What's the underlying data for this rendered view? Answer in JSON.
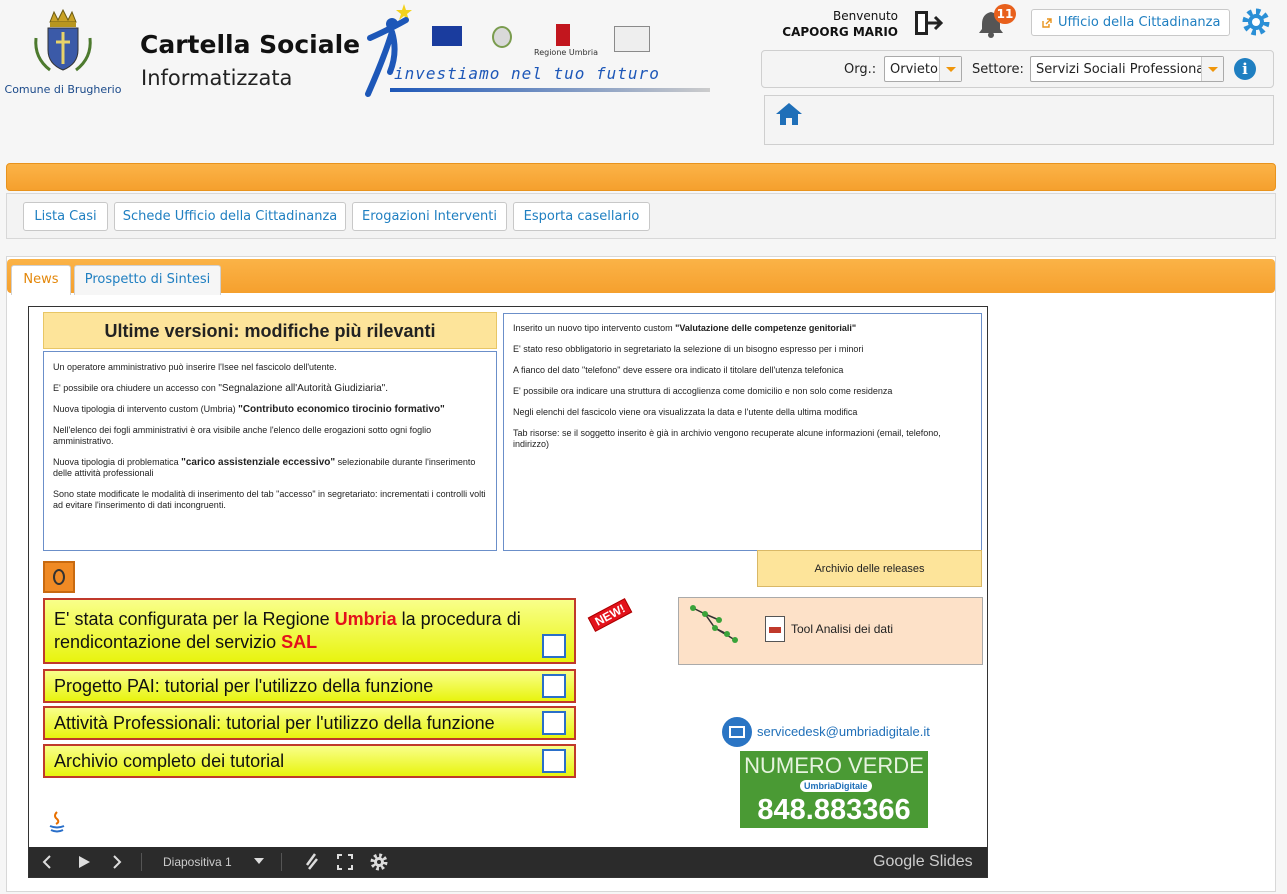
{
  "header": {
    "comune": "Comune di Brugherio",
    "app_title": "Cartella Sociale",
    "app_subtitle": "Informatizzata",
    "banner_text": "investiamo nel tuo futuro",
    "banner_region": "Regione Umbria",
    "welcome": "Benvenuto",
    "user": "CAPOORG MARIO",
    "notifications": "11",
    "ufficio_button": "Ufficio della Cittadinanza"
  },
  "org_panel": {
    "org_label": "Org.:",
    "org_value": "Orvieto",
    "settore_label": "Settore:",
    "settore_value": "Servizi Sociali Professionali"
  },
  "nav": [
    "Lista Casi",
    "Schede Ufficio della Cittadinanza",
    "Erogazioni Interventi",
    "Esporta casellario"
  ],
  "tabs": [
    "News",
    "Prospetto di Sintesi"
  ],
  "slide": {
    "title": "Ultime versioni: modifiche più rilevanti",
    "left_items": [
      "Un operatore amministrativo può inserire l'Isee nel fascicolo dell'utente.",
      "E' possibile ora chiudere un accesso con ",
      "Nuova tipologia di intervento custom (Umbria) ",
      "Nell'elenco dei fogli amministrativi è ora visibile anche l'elenco delle erogazioni sotto ogni foglio amministrativo.",
      "Nuova tipologia di problematica ",
      "Sono state modificate le modalità di inserimento del tab \"accesso\" in segretariato: incrementati i controlli volti ad evitare l'inserimento di dati incongruenti."
    ],
    "left_highlights": {
      "segnalazione": "\"Segnalazione all'Autorità Giudiziaria\".",
      "contributo": "\"Contributo economico tirocinio formativo\"",
      "carico": "\"carico assistenziale eccessivo\"",
      "carico_after": " selezionabile durante l'inserimento delle attività professionali"
    },
    "right_items": [
      "Inserito un nuovo tipo intervento custom ",
      "E' stato reso obbligatorio in segretariato la selezione di un bisogno espresso per i minori",
      "A fianco del dato \"telefono\" deve essere ora indicato il titolare dell'utenza telefonica",
      "E' possibile ora indicare una struttura di accoglienza come domicilio e non solo come residenza",
      "Negli elenchi del fascicolo viene ora visualizzata la data e l'utente della ultima modifica",
      "Tab risorse: se il soggetto inserito è già in archivio vengono recuperate alcune informazioni (email, telefono, indirizzo)"
    ],
    "right_highlight": "\"Valutazione delle competenze genitoriali\"",
    "archivio_releases": "Archivio delle releases",
    "link1_a": "E' stata configurata per la Regione ",
    "link1_umbria": "Umbria",
    "link1_b": " la procedura di rendicontazione del servizio ",
    "link1_sal": "SAL",
    "new_badge": "NEW!",
    "link2": "Progetto PAI: tutorial per l'utilizzo della funzione",
    "link3": "Attività Professionali: tutorial per l'utilizzo della funzione",
    "link4": "Archivio completo dei tutorial",
    "tool": "Tool Analisi dei dati",
    "email": "servicedesk@umbriadigitale.it",
    "numero_verde": "NUMERO VERDE",
    "umbria_digitale": "UmbriaDigitale",
    "phone": "848.883366"
  },
  "controls": {
    "slide_label": "Diapositiva 1",
    "brand": "Google Slides"
  },
  "colors": {
    "accent_orange": "#f5a02e",
    "link_blue": "#1f7fc1",
    "highlight_red": "#e3121b"
  }
}
